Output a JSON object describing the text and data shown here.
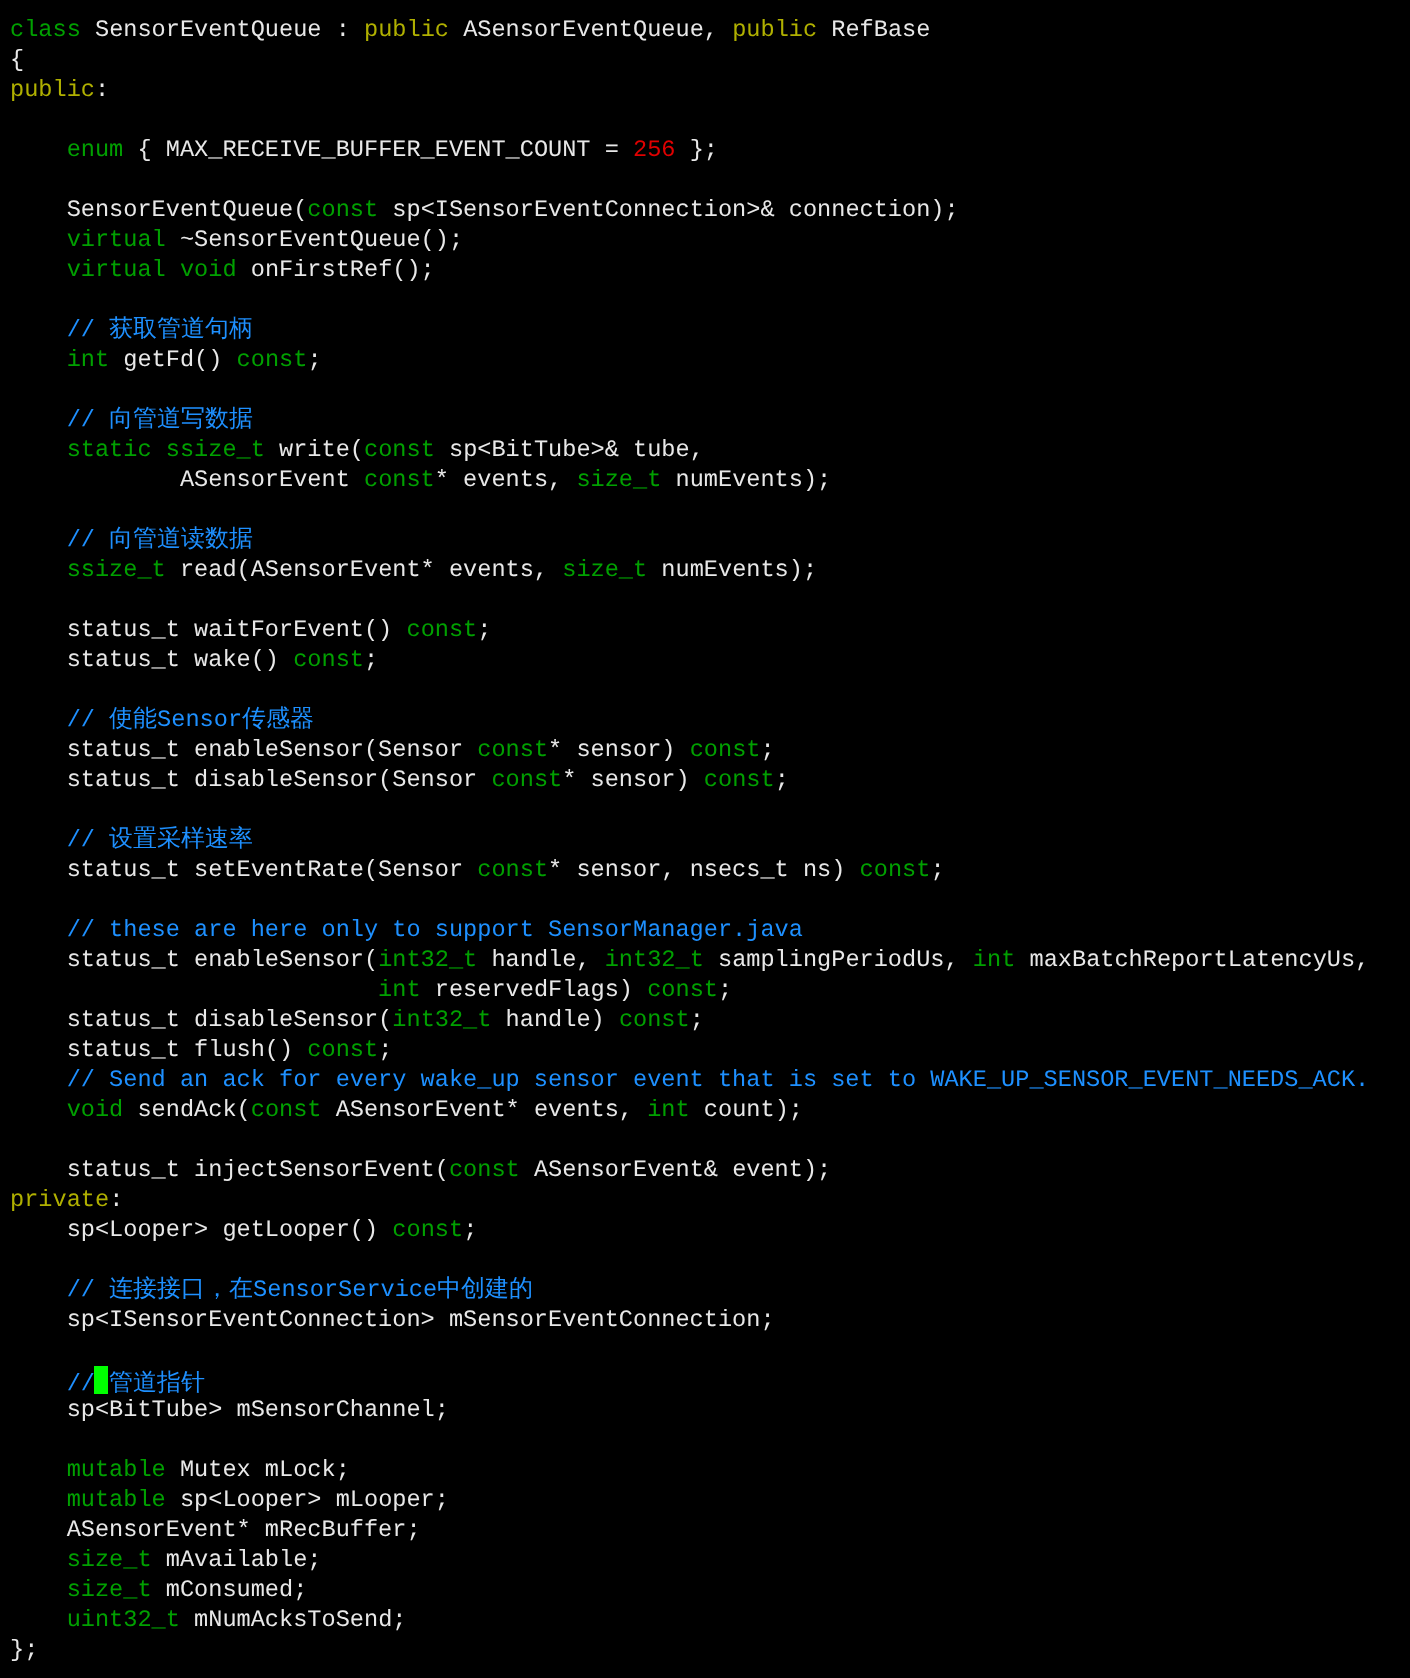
{
  "editor": {
    "lines": [
      {
        "kind": "code",
        "tokens": [
          {
            "kind": "type",
            "text": "class"
          },
          {
            "kind": "plain",
            "text": " SensorEventQueue : "
          },
          {
            "kind": "keyword",
            "text": "public"
          },
          {
            "kind": "plain",
            "text": " ASensorEventQueue, "
          },
          {
            "kind": "keyword",
            "text": "public"
          },
          {
            "kind": "plain",
            "text": " RefBase"
          }
        ]
      },
      {
        "kind": "code",
        "tokens": [
          {
            "kind": "plain",
            "text": "{"
          }
        ]
      },
      {
        "kind": "code",
        "tokens": [
          {
            "kind": "keyword",
            "text": "public"
          },
          {
            "kind": "plain",
            "text": ":"
          }
        ]
      },
      {
        "kind": "blank"
      },
      {
        "kind": "code",
        "tokens": [
          {
            "kind": "type",
            "text": "    enum"
          },
          {
            "kind": "plain",
            "text": " { MAX_RECEIVE_BUFFER_EVENT_COUNT = "
          },
          {
            "kind": "number",
            "text": "256"
          },
          {
            "kind": "plain",
            "text": " };"
          }
        ]
      },
      {
        "kind": "blank"
      },
      {
        "kind": "code",
        "tokens": [
          {
            "kind": "plain",
            "text": "    SensorEventQueue("
          },
          {
            "kind": "type",
            "text": "const"
          },
          {
            "kind": "plain",
            "text": " sp<ISensorEventConnection>& connection);"
          }
        ]
      },
      {
        "kind": "code",
        "tokens": [
          {
            "kind": "type",
            "text": "    virtual"
          },
          {
            "kind": "plain",
            "text": " ~SensorEventQueue();"
          }
        ]
      },
      {
        "kind": "code",
        "tokens": [
          {
            "kind": "type",
            "text": "    virtual void"
          },
          {
            "kind": "plain",
            "text": " onFirstRef();"
          }
        ]
      },
      {
        "kind": "blank"
      },
      {
        "kind": "code",
        "tokens": [
          {
            "kind": "comment",
            "text": "    // 获取管道句柄"
          }
        ]
      },
      {
        "kind": "code",
        "tokens": [
          {
            "kind": "type",
            "text": "    int"
          },
          {
            "kind": "plain",
            "text": " getFd() "
          },
          {
            "kind": "type",
            "text": "const"
          },
          {
            "kind": "plain",
            "text": ";"
          }
        ]
      },
      {
        "kind": "blank"
      },
      {
        "kind": "code",
        "tokens": [
          {
            "kind": "comment",
            "text": "    // 向管道写数据"
          }
        ]
      },
      {
        "kind": "code",
        "tokens": [
          {
            "kind": "type",
            "text": "    static ssize_t"
          },
          {
            "kind": "plain",
            "text": " write("
          },
          {
            "kind": "type",
            "text": "const"
          },
          {
            "kind": "plain",
            "text": " sp<BitTube>& tube,"
          }
        ]
      },
      {
        "kind": "code",
        "tokens": [
          {
            "kind": "plain",
            "text": "            ASensorEvent "
          },
          {
            "kind": "type",
            "text": "const"
          },
          {
            "kind": "plain",
            "text": "* events, "
          },
          {
            "kind": "type",
            "text": "size_t"
          },
          {
            "kind": "plain",
            "text": " numEvents);"
          }
        ]
      },
      {
        "kind": "blank"
      },
      {
        "kind": "code",
        "tokens": [
          {
            "kind": "comment",
            "text": "    // 向管道读数据"
          }
        ]
      },
      {
        "kind": "code",
        "tokens": [
          {
            "kind": "type",
            "text": "    ssize_t"
          },
          {
            "kind": "plain",
            "text": " read(ASensorEvent* events, "
          },
          {
            "kind": "type",
            "text": "size_t"
          },
          {
            "kind": "plain",
            "text": " numEvents);"
          }
        ]
      },
      {
        "kind": "blank"
      },
      {
        "kind": "code",
        "tokens": [
          {
            "kind": "plain",
            "text": "    status_t waitForEvent() "
          },
          {
            "kind": "type",
            "text": "const"
          },
          {
            "kind": "plain",
            "text": ";"
          }
        ]
      },
      {
        "kind": "code",
        "tokens": [
          {
            "kind": "plain",
            "text": "    status_t wake() "
          },
          {
            "kind": "type",
            "text": "const"
          },
          {
            "kind": "plain",
            "text": ";"
          }
        ]
      },
      {
        "kind": "blank"
      },
      {
        "kind": "code",
        "tokens": [
          {
            "kind": "comment",
            "text": "    // 使能Sensor传感器"
          }
        ]
      },
      {
        "kind": "code",
        "tokens": [
          {
            "kind": "plain",
            "text": "    status_t enableSensor(Sensor "
          },
          {
            "kind": "type",
            "text": "const"
          },
          {
            "kind": "plain",
            "text": "* sensor) "
          },
          {
            "kind": "type",
            "text": "const"
          },
          {
            "kind": "plain",
            "text": ";"
          }
        ]
      },
      {
        "kind": "code",
        "tokens": [
          {
            "kind": "plain",
            "text": "    status_t disableSensor(Sensor "
          },
          {
            "kind": "type",
            "text": "const"
          },
          {
            "kind": "plain",
            "text": "* sensor) "
          },
          {
            "kind": "type",
            "text": "const"
          },
          {
            "kind": "plain",
            "text": ";"
          }
        ]
      },
      {
        "kind": "blank"
      },
      {
        "kind": "code",
        "tokens": [
          {
            "kind": "comment",
            "text": "    // 设置采样速率"
          }
        ]
      },
      {
        "kind": "code",
        "tokens": [
          {
            "kind": "plain",
            "text": "    status_t setEventRate(Sensor "
          },
          {
            "kind": "type",
            "text": "const"
          },
          {
            "kind": "plain",
            "text": "* sensor, nsecs_t ns) "
          },
          {
            "kind": "type",
            "text": "const"
          },
          {
            "kind": "plain",
            "text": ";"
          }
        ]
      },
      {
        "kind": "blank"
      },
      {
        "kind": "code",
        "tokens": [
          {
            "kind": "comment",
            "text": "    // these are here only to support SensorManager.java"
          }
        ]
      },
      {
        "kind": "code",
        "tokens": [
          {
            "kind": "plain",
            "text": "    status_t enableSensor("
          },
          {
            "kind": "type",
            "text": "int32_t"
          },
          {
            "kind": "plain",
            "text": " handle, "
          },
          {
            "kind": "type",
            "text": "int32_t"
          },
          {
            "kind": "plain",
            "text": " samplingPeriodUs, "
          },
          {
            "kind": "type",
            "text": "int"
          },
          {
            "kind": "plain",
            "text": " maxBatchReportLatencyUs,"
          }
        ]
      },
      {
        "kind": "code",
        "tokens": [
          {
            "kind": "type",
            "text": "                          int"
          },
          {
            "kind": "plain",
            "text": " reservedFlags) "
          },
          {
            "kind": "type",
            "text": "const"
          },
          {
            "kind": "plain",
            "text": ";"
          }
        ]
      },
      {
        "kind": "code",
        "tokens": [
          {
            "kind": "plain",
            "text": "    status_t disableSensor("
          },
          {
            "kind": "type",
            "text": "int32_t"
          },
          {
            "kind": "plain",
            "text": " handle) "
          },
          {
            "kind": "type",
            "text": "const"
          },
          {
            "kind": "plain",
            "text": ";"
          }
        ]
      },
      {
        "kind": "code",
        "tokens": [
          {
            "kind": "plain",
            "text": "    status_t flush() "
          },
          {
            "kind": "type",
            "text": "const"
          },
          {
            "kind": "plain",
            "text": ";"
          }
        ]
      },
      {
        "kind": "code",
        "tokens": [
          {
            "kind": "comment",
            "text": "    // Send an ack for every wake_up sensor event that is set to WAKE_UP_SENSOR_EVENT_NEEDS_ACK."
          }
        ]
      },
      {
        "kind": "code",
        "tokens": [
          {
            "kind": "type",
            "text": "    void"
          },
          {
            "kind": "plain",
            "text": " sendAck("
          },
          {
            "kind": "type",
            "text": "const"
          },
          {
            "kind": "plain",
            "text": " ASensorEvent* events, "
          },
          {
            "kind": "type",
            "text": "int"
          },
          {
            "kind": "plain",
            "text": " count);"
          }
        ]
      },
      {
        "kind": "blank"
      },
      {
        "kind": "code",
        "tokens": [
          {
            "kind": "plain",
            "text": "    status_t injectSensorEvent("
          },
          {
            "kind": "type",
            "text": "const"
          },
          {
            "kind": "plain",
            "text": " ASensorEvent& event);"
          }
        ]
      },
      {
        "kind": "code",
        "tokens": [
          {
            "kind": "keyword",
            "text": "private"
          },
          {
            "kind": "plain",
            "text": ":"
          }
        ]
      },
      {
        "kind": "code",
        "tokens": [
          {
            "kind": "plain",
            "text": "    sp<Looper> getLooper() "
          },
          {
            "kind": "type",
            "text": "const"
          },
          {
            "kind": "plain",
            "text": ";"
          }
        ]
      },
      {
        "kind": "blank"
      },
      {
        "kind": "code",
        "tokens": [
          {
            "kind": "comment",
            "text": "    // 连接接口，在SensorService中创建的"
          }
        ]
      },
      {
        "kind": "code",
        "tokens": [
          {
            "kind": "plain",
            "text": "    sp<ISensorEventConnection> mSensorEventConnection;"
          }
        ]
      },
      {
        "kind": "blank"
      },
      {
        "kind": "code",
        "tokens": [
          {
            "kind": "comment",
            "text": "    //"
          },
          {
            "kind": "comment",
            "text": "管道指针",
            "cursor_before": true
          }
        ]
      },
      {
        "kind": "code",
        "tokens": [
          {
            "kind": "plain",
            "text": "    sp<BitTube> mSensorChannel;"
          }
        ]
      },
      {
        "kind": "blank"
      },
      {
        "kind": "code",
        "tokens": [
          {
            "kind": "type",
            "text": "    mutable"
          },
          {
            "kind": "plain",
            "text": " Mutex mLock;"
          }
        ]
      },
      {
        "kind": "code",
        "tokens": [
          {
            "kind": "type",
            "text": "    mutable"
          },
          {
            "kind": "plain",
            "text": " sp<Looper> mLooper;"
          }
        ]
      },
      {
        "kind": "code",
        "tokens": [
          {
            "kind": "plain",
            "text": "    ASensorEvent* mRecBuffer;"
          }
        ]
      },
      {
        "kind": "code",
        "tokens": [
          {
            "kind": "type",
            "text": "    size_t"
          },
          {
            "kind": "plain",
            "text": " mAvailable;"
          }
        ]
      },
      {
        "kind": "code",
        "tokens": [
          {
            "kind": "type",
            "text": "    size_t"
          },
          {
            "kind": "plain",
            "text": " mConsumed;"
          }
        ]
      },
      {
        "kind": "code",
        "tokens": [
          {
            "kind": "type",
            "text": "    uint32_t"
          },
          {
            "kind": "plain",
            "text": " mNumAcksToSend;"
          }
        ]
      },
      {
        "kind": "code",
        "tokens": [
          {
            "kind": "plain",
            "text": "};"
          }
        ]
      }
    ]
  }
}
